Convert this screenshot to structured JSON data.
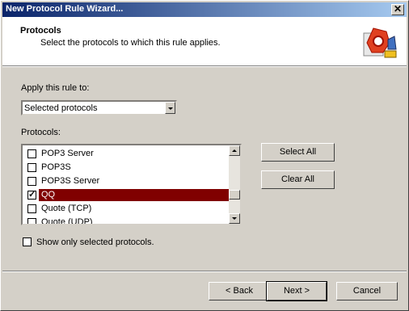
{
  "window": {
    "title": "New Protocol Rule Wizard...",
    "close_glyph": "✕"
  },
  "header": {
    "title": "Protocols",
    "subtitle": "Select the protocols to which this rule applies.",
    "logo_icon": "wizard-logo-icon"
  },
  "apply": {
    "label": "Apply this rule to:",
    "selected": "Selected protocols"
  },
  "protocols": {
    "label": "Protocols:",
    "items": [
      {
        "label": "POP3 Server",
        "checked": false
      },
      {
        "label": "POP3S",
        "checked": false
      },
      {
        "label": "POP3S Server",
        "checked": false
      },
      {
        "label": "QQ",
        "checked": true
      },
      {
        "label": "Quote (TCP)",
        "checked": false
      },
      {
        "label": "Quote (UDP)",
        "checked": false
      }
    ],
    "selected_index": 3
  },
  "buttons": {
    "select_all": "Select All",
    "clear_all": "Clear All",
    "back": "< Back",
    "next": "Next >",
    "cancel": "Cancel"
  },
  "show_only": {
    "label": "Show only selected protocols.",
    "checked": false
  },
  "colors": {
    "selection": "#800000",
    "titlebar_start": "#0a246a",
    "titlebar_end": "#a6caf0"
  }
}
